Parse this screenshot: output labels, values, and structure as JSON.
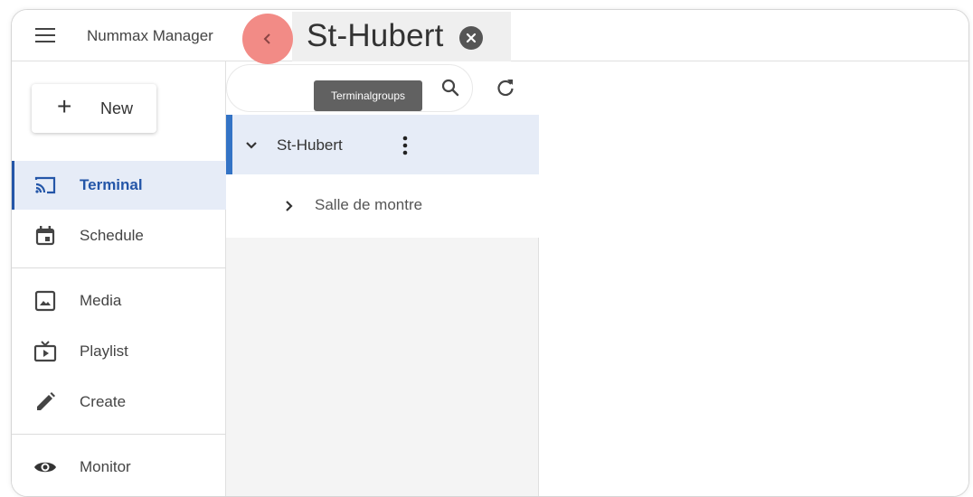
{
  "header": {
    "menu_icon": "hamburger-menu-icon",
    "app_title": "Nummax Manager",
    "back_icon": "chevron-left-icon",
    "tab_title": "St-Hubert",
    "tab_close_icon": "close-circle-icon"
  },
  "sidebar": {
    "new_button": {
      "icon": "plus-icon",
      "label": "New"
    },
    "items": [
      {
        "label": "Terminal",
        "icon": "cast-icon",
        "active": true
      },
      {
        "label": "Schedule",
        "icon": "calendar-icon",
        "active": false
      },
      {
        "label": "Media",
        "icon": "image-icon",
        "active": false
      },
      {
        "label": "Playlist",
        "icon": "tv-play-icon",
        "active": false
      },
      {
        "label": "Create",
        "icon": "pencil-icon",
        "active": false
      },
      {
        "label": "Monitor",
        "icon": "eye-icon",
        "active": false
      }
    ]
  },
  "middle": {
    "search_icon": "search-icon",
    "refresh_icon": "refresh-icon",
    "tooltip": "Terminalgroups",
    "tree": [
      {
        "label": "St-Hubert",
        "expanded": true,
        "selected": true,
        "icon": "chevron-down-icon",
        "menu_icon": "more-vertical-icon"
      },
      {
        "label": "Salle de montre",
        "expanded": false,
        "selected": false,
        "icon": "chevron-right-icon"
      }
    ]
  },
  "colors": {
    "accent": "#2456a8",
    "selected_bg": "#e6ecf7",
    "back_button": "#f28b86",
    "tooltip_bg": "#616161"
  }
}
